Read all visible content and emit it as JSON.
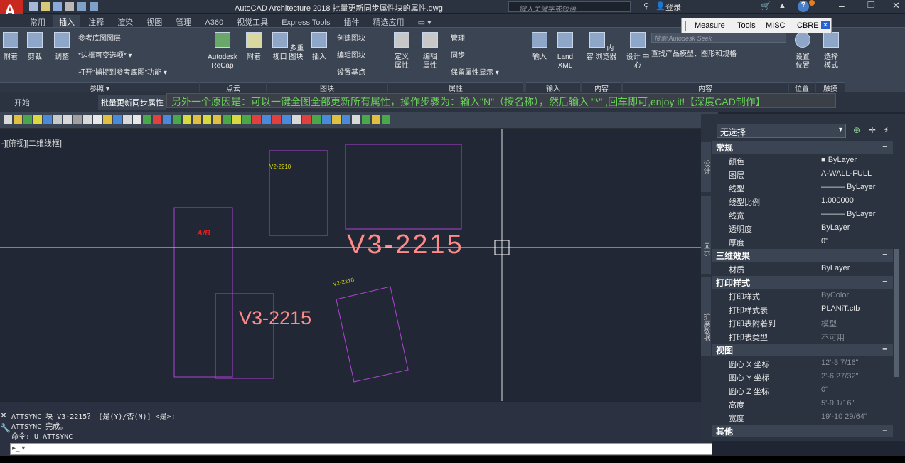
{
  "app": {
    "title": "AutoCAD Architecture 2018  批量更新同步属性块的属性.dwg",
    "search_placeholder": "键入关键字或短语",
    "login": "登录",
    "help": "?"
  },
  "quick_access": {
    "logo": "A"
  },
  "ribbon_tabs": [
    "常用",
    "插入",
    "注释",
    "渲染",
    "视图",
    "管理",
    "A360",
    "视觉工具",
    "Express Tools",
    "插件",
    "精选应用"
  ],
  "active_tab": "插入",
  "ribbon": {
    "groups": [
      {
        "label": "参照 ▾"
      },
      {
        "label": "点云"
      },
      {
        "label": "图块"
      },
      {
        "label": "属性"
      },
      {
        "label": "输入"
      },
      {
        "label": "内容"
      },
      {
        "label": "内容"
      },
      {
        "label": "位置"
      },
      {
        "label": "触摸"
      }
    ],
    "buttons": {
      "attach": "附着",
      "clip": "剪裁",
      "adjust": "调整",
      "underlay_layers": "参考底图图层",
      "frame_var": "*边框可变选项* ▾",
      "snap_underlay": "打开\"捕捉到参考底图\"功能 ▾",
      "recap": "Autodesk ReCap",
      "attach2": "附着",
      "multi_view": "多重视口 图块",
      "insert": "插入",
      "create_block": "创建图块",
      "edit_block": "编辑图块",
      "set_base": "设置基点",
      "define_attr": "定义 属性",
      "edit_attr": "编辑 属性",
      "manage": "管理",
      "sync": "同步",
      "keep_attr": "保留属性显示 ▾",
      "import": "输入",
      "land_xml": "Land XML",
      "content_browser": "内容 浏览器",
      "design_center": "设计 中心",
      "seek_search": "搜索 Autodesk Seek",
      "seek_desc": "查找产品模型、图形和规格",
      "set_location": "设置 位置",
      "select_mode": "选择 模式"
    },
    "float_toolbar": [
      "Measure",
      "Tools",
      "MISC",
      "CBRE"
    ]
  },
  "doc_tabs": {
    "start": "开始",
    "current": "批量更新同步属性",
    "banner": "另外一个原因是：可以一键全图全部更新所有属性，操作步骤为：输入\"N\"（按名称），然后输入 \"*\" ,回车即可,enjoy it!【深度CAD制作】"
  },
  "viewport_label": "-][俯视][二维线框]",
  "canvas": {
    "big_text": "V3-2215",
    "mid_text": "V3-2215",
    "small_tag1": "V2-2210",
    "small_tag2": "V2-2210"
  },
  "command_line": {
    "lines": [
      "ATTSYNC 块 V3-2215？ [是(Y)/否(N)] <是>:",
      "ATTSYNC 完成。",
      "命令: U ATTSYNC"
    ],
    "prompt": "▸_ ▾"
  },
  "properties": {
    "selection": "无选择",
    "side_tabs": [
      "设计",
      "显示",
      "扩展数据"
    ],
    "sections": [
      {
        "title": "常规",
        "rows": [
          {
            "k": "颜色",
            "v": "■ ByLayer"
          },
          {
            "k": "图层",
            "v": "A-WALL-FULL"
          },
          {
            "k": "线型",
            "v": "——— ByLayer"
          },
          {
            "k": "线型比例",
            "v": "1.000000"
          },
          {
            "k": "线宽",
            "v": "——— ByLayer"
          },
          {
            "k": "透明度",
            "v": "ByLayer"
          },
          {
            "k": "厚度",
            "v": "0\""
          }
        ]
      },
      {
        "title": "三维效果",
        "rows": [
          {
            "k": "材质",
            "v": "ByLayer"
          }
        ]
      },
      {
        "title": "打印样式",
        "rows": [
          {
            "k": "打印样式",
            "v": "ByColor",
            "dim": true
          },
          {
            "k": "打印样式表",
            "v": "PLANiT.ctb"
          },
          {
            "k": "打印表附着到",
            "v": "模型",
            "dim": true
          },
          {
            "k": "打印表类型",
            "v": "不可用",
            "dim": true
          }
        ]
      },
      {
        "title": "视图",
        "rows": [
          {
            "k": "圆心 X 坐标",
            "v": "12'-3 7/16\"",
            "dim": true
          },
          {
            "k": "圆心 Y 坐标",
            "v": "2'-6 27/32\"",
            "dim": true
          },
          {
            "k": "圆心 Z 坐标",
            "v": "0\"",
            "dim": true
          },
          {
            "k": "高度",
            "v": "5'-9 1/16\"",
            "dim": true
          },
          {
            "k": "宽度",
            "v": "19'-10 29/64\"",
            "dim": true
          }
        ]
      },
      {
        "title": "其他",
        "rows": []
      }
    ]
  },
  "colors": {
    "accent": "#ff8a8a",
    "magenta": "#b043d8",
    "banner_green": "#6ad05a",
    "yellow_text": "#d8d800"
  }
}
